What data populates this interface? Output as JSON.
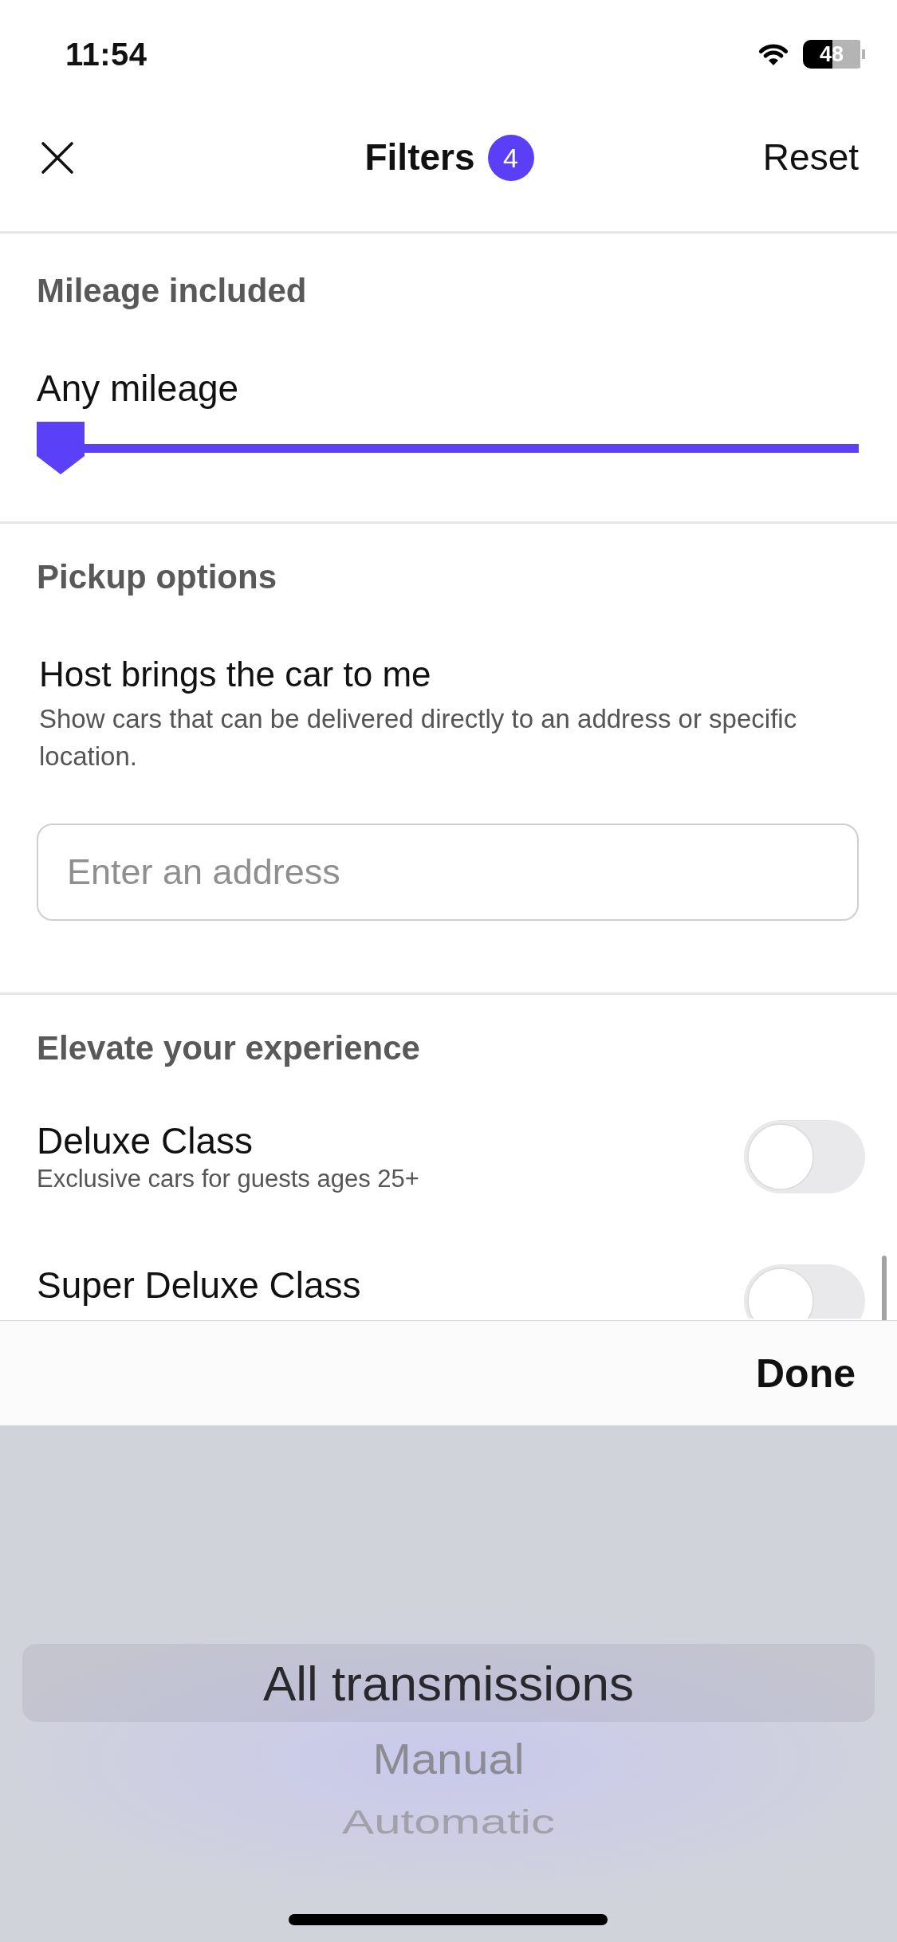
{
  "status_bar": {
    "time": "11:54",
    "battery": "48"
  },
  "header": {
    "title": "Filters",
    "badge": "4",
    "reset": "Reset"
  },
  "sections": [
    {
      "kind": "slider",
      "title": "Mileage included",
      "reading": "Any mileage",
      "level": 0
    },
    {
      "kind": "address",
      "title": "Pickup options",
      "option_title": "Host brings the car to me",
      "option_description": "Show cars that can be delivered directly to an address or specific location.",
      "placeholder": "Enter an address"
    },
    {
      "kind": "toggles",
      "title": "Elevate your experience",
      "options": [
        {
          "label": "Deluxe Class",
          "description": "Exclusive cars for guests ages 25+",
          "on": false
        },
        {
          "label": "Super Deluxe Class",
          "on": false
        }
      ]
    }
  ],
  "picker": {
    "done": "Done",
    "items": [
      {
        "label": "All transmissions",
        "selected": true
      },
      {
        "label": "Manual",
        "selected": false
      },
      {
        "label": "Automatic",
        "selected": false
      }
    ]
  }
}
